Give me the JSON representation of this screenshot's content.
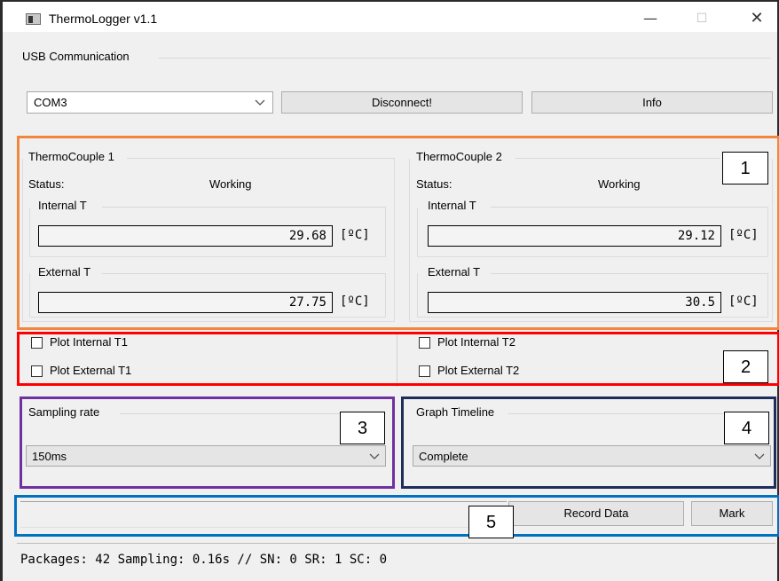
{
  "window": {
    "title": "ThermoLogger v1.1",
    "minimize_glyph": "—",
    "maximize_glyph": "☐",
    "close_glyph": "✕"
  },
  "usb": {
    "group_label": "USB Communication",
    "port_value": "COM3",
    "disconnect_label": "Disconnect!",
    "info_label": "Info"
  },
  "tc1": {
    "group_label": "ThermoCouple 1",
    "status_label": "Status:",
    "status_value": "Working",
    "internal_label": "Internal T",
    "internal_value": "29.68",
    "external_label": "External T",
    "external_value": "27.75",
    "unit": "[ºC]"
  },
  "tc2": {
    "group_label": "ThermoCouple 2",
    "status_label": "Status:",
    "status_value": "Working",
    "internal_label": "Internal T",
    "internal_value": "29.12",
    "external_label": "External T",
    "external_value": "30.5",
    "unit": "[ºC]"
  },
  "plots": {
    "internal_t1": "Plot Internal T1",
    "external_t1": "Plot External T1",
    "internal_t2": "Plot Internal T2",
    "external_t2": "Plot External T2"
  },
  "sampling": {
    "label": "Sampling rate",
    "value": "150ms"
  },
  "timeline": {
    "label": "Graph Timeline",
    "value": "Complete"
  },
  "actions": {
    "record_label": "Record Data",
    "mark_label": "Mark"
  },
  "status_bar": {
    "text": "Packages: 42 Sampling: 0.16s // SN: 0 SR: 1 SC: 0"
  },
  "annotations": {
    "n1": "1",
    "n2": "2",
    "n3": "3",
    "n4": "4",
    "n5": "5"
  },
  "colors": {
    "orange": "#f0873c",
    "red": "#ff0000",
    "purple": "#7030a0",
    "navy": "#1f2d5a",
    "blue": "#0070c0"
  }
}
